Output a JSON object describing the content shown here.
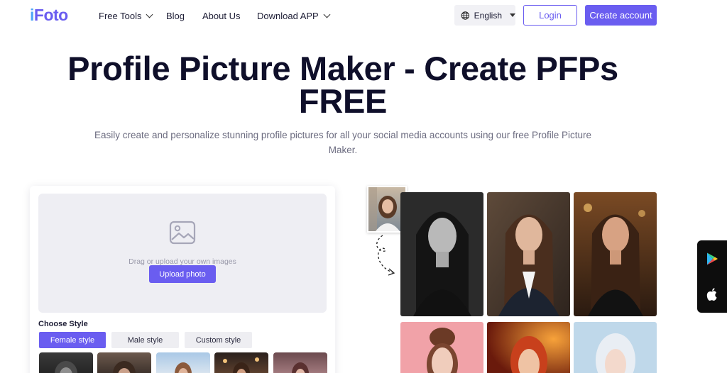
{
  "nav": {
    "logo_prefix": "i",
    "logo_rest": "Foto",
    "items": [
      {
        "label": "Free Tools",
        "dropdown": true
      },
      {
        "label": "Blog",
        "dropdown": false
      },
      {
        "label": "About Us",
        "dropdown": false
      },
      {
        "label": "Download APP",
        "dropdown": true
      }
    ],
    "language": "English",
    "login_label": "Login",
    "create_label": "Create account"
  },
  "hero": {
    "title_line1": "Profile Picture Maker - Create PFPs",
    "title_line2": "FREE",
    "subtitle_line1": "Easily create and personalize stunning profile pictures for all your social media accounts using our free Profile Picture",
    "subtitle_line2": "Maker."
  },
  "upload": {
    "drop_text": "Drag or upload your own images",
    "upload_label": "Upload photo",
    "choose_style": "Choose Style",
    "tabs": [
      {
        "label": "Female style",
        "active": true
      },
      {
        "label": "Male style",
        "active": false
      },
      {
        "label": "Custom style",
        "active": false
      }
    ]
  },
  "icons": {
    "globe": "globe-icon",
    "image": "image-placeholder-icon",
    "google_play": "google-play-icon",
    "apple": "apple-icon"
  },
  "colors": {
    "accent": "#6a5df0",
    "logo_i": "#4fa6f7",
    "title": "#0f0f2a"
  }
}
